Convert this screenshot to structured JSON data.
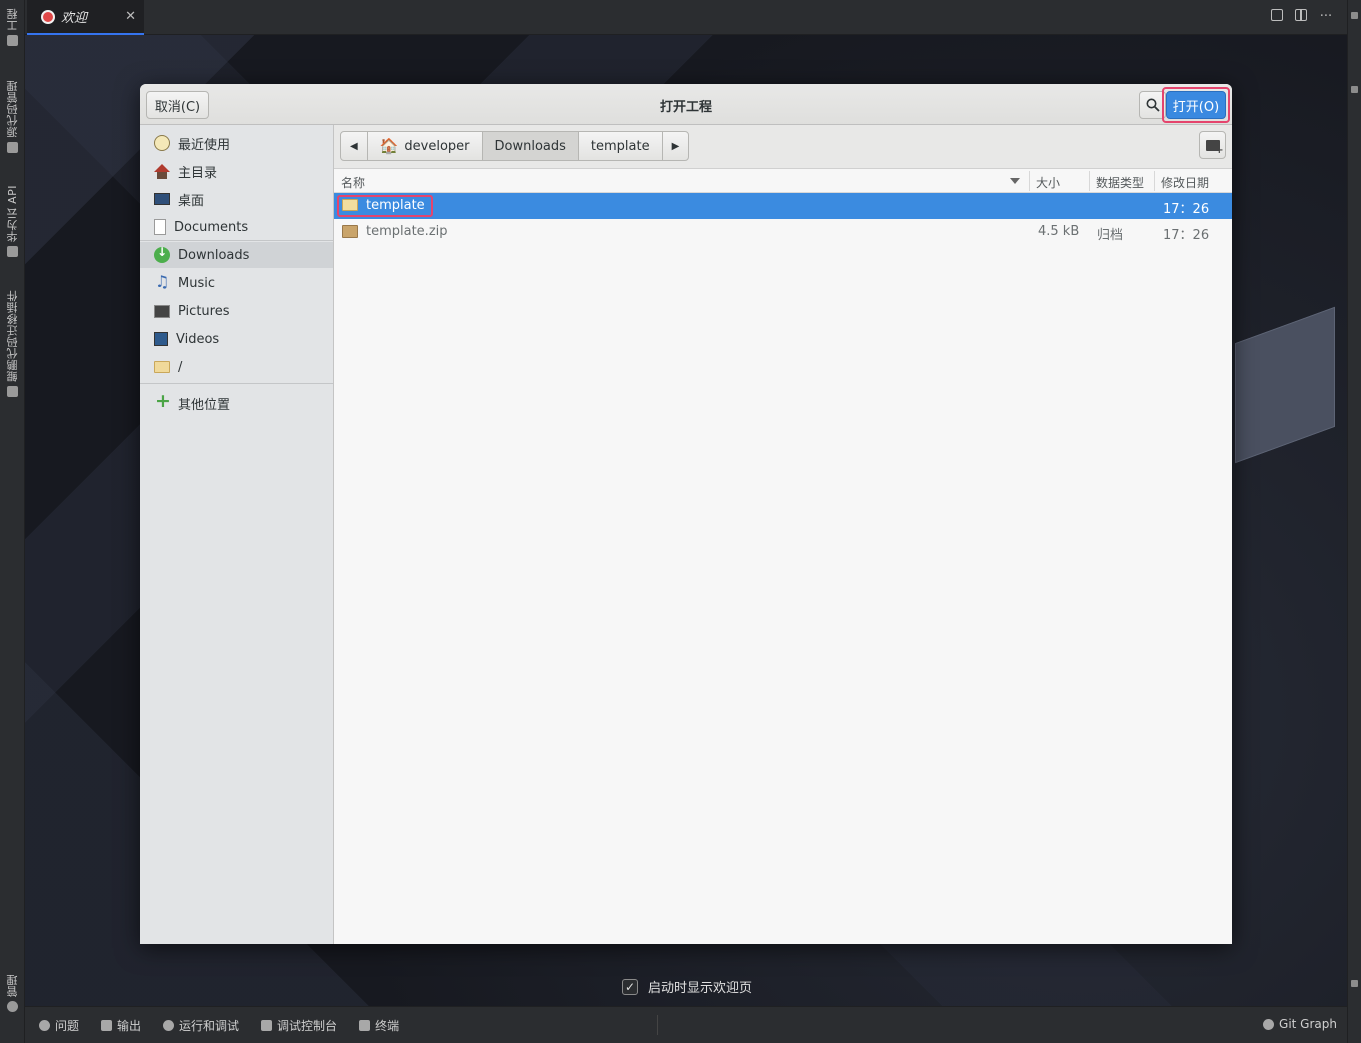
{
  "left_bar": {
    "items": [
      {
        "label": "工程"
      },
      {
        "label": "源代码管理"
      },
      {
        "label": "华为云 API"
      },
      {
        "label": "鲲鹏代码迁移插件"
      },
      {
        "label": "管理"
      }
    ]
  },
  "tabs": [
    {
      "label": "欢迎"
    }
  ],
  "tabbar": {
    "more": "···"
  },
  "dialog": {
    "title": "打开工程",
    "cancel_label": "取消(C)",
    "open_label": "打开(O)",
    "search_icon": "search-icon"
  },
  "sidebar": {
    "places": [
      {
        "label": "最近使用",
        "icon": "recent-icon"
      },
      {
        "label": "主目录",
        "icon": "home-icon"
      },
      {
        "label": "桌面",
        "icon": "desktop-icon"
      },
      {
        "label": "Documents",
        "icon": "document-icon"
      },
      {
        "label": "Downloads",
        "icon": "download-icon"
      },
      {
        "label": "Music",
        "icon": "music-icon"
      },
      {
        "label": "Pictures",
        "icon": "pictures-icon"
      },
      {
        "label": "Videos",
        "icon": "videos-icon"
      },
      {
        "label": "/",
        "icon": "folder-icon"
      }
    ],
    "other_locations": "其他位置"
  },
  "pathbar": {
    "crumbs": [
      "developer",
      "Downloads",
      "template"
    ],
    "back_glyph": "◀",
    "forward_glyph": "▶",
    "home_glyph": "🏠"
  },
  "columns": {
    "name": "名称",
    "size": "大小",
    "type": "数据类型",
    "modified": "修改日期"
  },
  "files": [
    {
      "name": "template",
      "size": "",
      "type": "",
      "modified": "17：26",
      "selected": true
    },
    {
      "name": "template.zip",
      "size": "4.5 kB",
      "type": "归档",
      "modified": "17：26",
      "selected": false
    }
  ],
  "welcome": {
    "show_on_startup": "启动时显示欢迎页",
    "check_glyph": "✓"
  },
  "statusbar": {
    "problems": "问题",
    "output": "输出",
    "run_debug": "运行和调试",
    "debug_console": "调试控制台",
    "terminal": "终端",
    "git_graph": "Git Graph"
  },
  "colors": {
    "accent": "#3b8be0",
    "highlight_border": "#e5446d"
  }
}
